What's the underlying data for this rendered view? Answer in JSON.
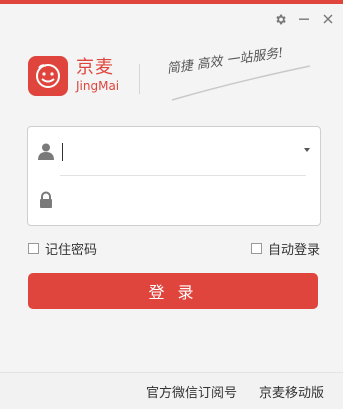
{
  "window": {
    "accent": "#e0453d",
    "controls": {
      "settings_icon": "gear-icon",
      "minimize_icon": "minimize-icon",
      "close_icon": "close-icon"
    }
  },
  "brand": {
    "name": "京麦",
    "name_en": "JingMai",
    "slogan": "简捷 高效 一站服务!"
  },
  "form": {
    "username": {
      "value": "",
      "placeholder": ""
    },
    "password": {
      "value": "",
      "placeholder": ""
    },
    "remember_label": "记住密码",
    "autologin_label": "自动登录",
    "login_button": "登 录"
  },
  "footer": {
    "wechat_link": "官方微信订阅号",
    "mobile_link": "京麦移动版"
  }
}
